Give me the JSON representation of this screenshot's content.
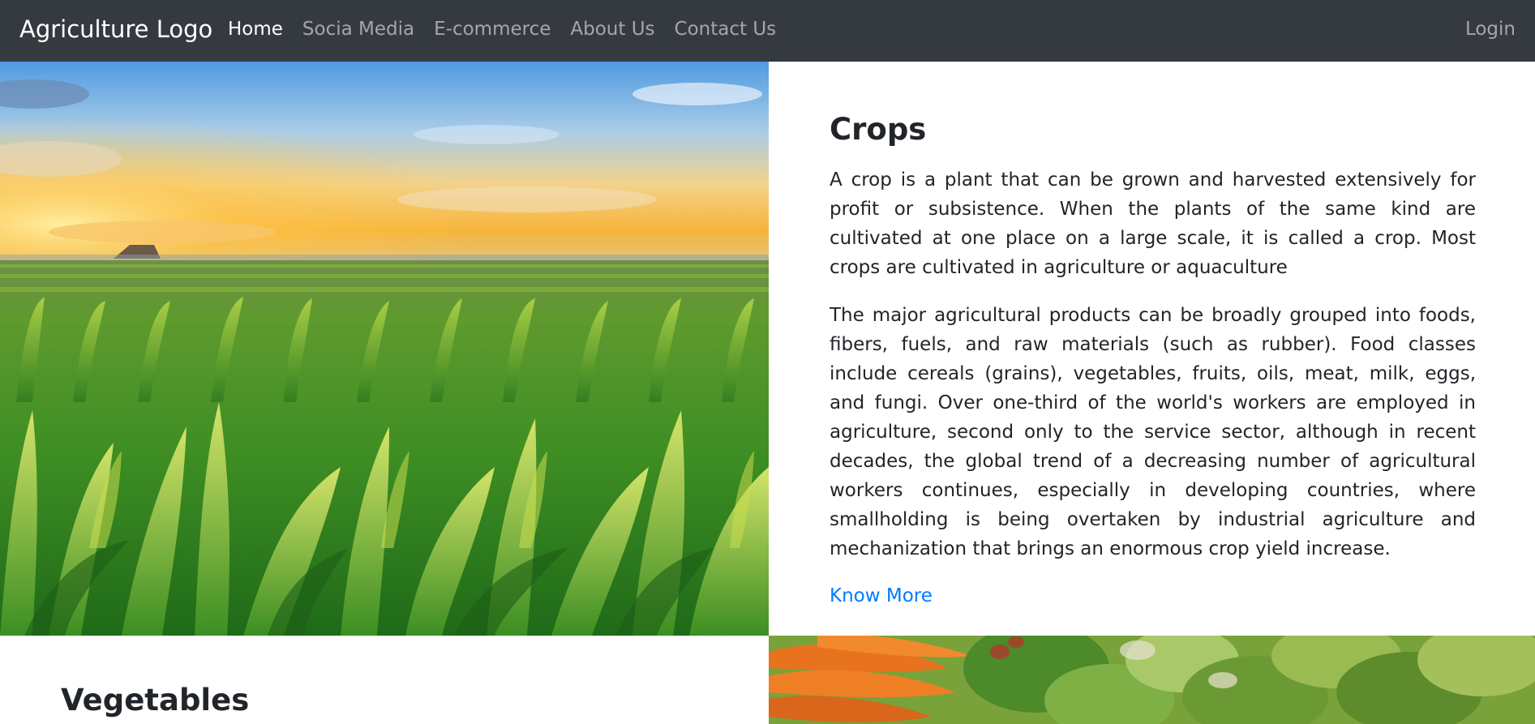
{
  "navbar": {
    "brand": "Agriculture Logo",
    "links": [
      {
        "label": "Home",
        "active": true
      },
      {
        "label": "Socia Media",
        "active": false
      },
      {
        "label": "E-commerce",
        "active": false
      },
      {
        "label": "About Us",
        "active": false
      },
      {
        "label": "Contact Us",
        "active": false
      }
    ],
    "login": "Login"
  },
  "crops": {
    "title": "Crops",
    "paragraph1": "A crop is a plant that can be grown and harvested extensively for profit or subsistence. When the plants of the same kind are cultivated at one place on a large scale, it is called a crop. Most crops are cultivated in agriculture or aquaculture",
    "paragraph2": "The major agricultural products can be broadly grouped into foods, fibers, fuels, and raw materials (such as rubber). Food classes include cereals (grains), vegetables, fruits, oils, meat, milk, eggs, and fungi. Over one-third of the world's workers are employed in agriculture, second only to the service sector, although in recent decades, the global trend of a decreasing number of agricultural workers continues, especially in developing countries, where smallholding is being overtaken by industrial agriculture and mechanization that brings an enormous crop yield increase.",
    "link": "Know More"
  },
  "vegetables": {
    "title": "Vegetables"
  },
  "colors": {
    "navbar_bg": "#343a40",
    "link": "#007bff",
    "text": "#212529"
  }
}
